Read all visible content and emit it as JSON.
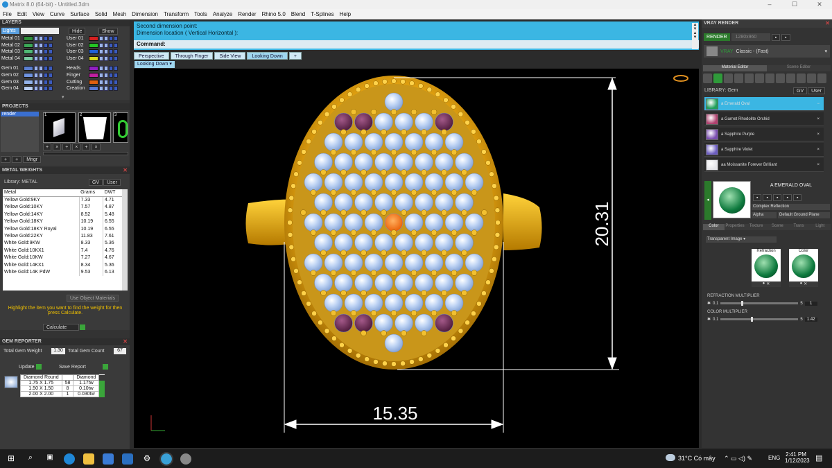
{
  "window": {
    "title": "Matrix 8.0 (64-bit) - Untitled.3dm",
    "controls": [
      "–",
      "☐",
      "✕"
    ]
  },
  "menu": [
    "File",
    "Edit",
    "View",
    "Curve",
    "Surface",
    "Solid",
    "Mesh",
    "Dimension",
    "Transform",
    "Tools",
    "Analyze",
    "Render",
    "Rhino 5.0",
    "Blend",
    "T-Splines",
    "Help"
  ],
  "layers": {
    "title": "LAYERS",
    "lights_label": "Lights",
    "hide_label": "Hide",
    "show_label": "Show",
    "left": [
      {
        "name": "Metal 01",
        "color": "#2f8f3a"
      },
      {
        "name": "Metal 02",
        "color": "#3aa655"
      },
      {
        "name": "Metal 03",
        "color": "#4fb874"
      },
      {
        "name": "Metal 04",
        "color": "#79c9a0"
      },
      {
        "name": "Gem 01",
        "color": "#5b7fd0"
      },
      {
        "name": "Gem 02",
        "color": "#6f93e0"
      },
      {
        "name": "Gem 03",
        "color": "#93b2ea"
      },
      {
        "name": "Gem 04",
        "color": "#b8cdf2"
      }
    ],
    "right": [
      {
        "name": "User 01",
        "color": "#d42020"
      },
      {
        "name": "User 02",
        "color": "#24c424"
      },
      {
        "name": "User 03",
        "color": "#2060d8"
      },
      {
        "name": "User 04",
        "color": "#d8d820"
      },
      {
        "name": "Heads",
        "color": "#9020c0"
      },
      {
        "name": "Finger",
        "color": "#c020a0"
      },
      {
        "name": "Cutting",
        "color": "#e06010"
      },
      {
        "name": "Creation",
        "color": "#5a7ad6"
      }
    ]
  },
  "projects": {
    "title": "PROJECTS",
    "item": "render",
    "thumb_nums": [
      "1",
      "2",
      "3"
    ],
    "mngr_label": "Mngr"
  },
  "metal_weights": {
    "title": "METAL WEIGHTS",
    "library_label": "Library: METAL",
    "gv_label": "GV",
    "user_label": "User",
    "columns": [
      "Metal",
      "Grams",
      "DWT"
    ],
    "rows": [
      [
        "Yellow Gold:9KY",
        "7.33",
        "4.71"
      ],
      [
        "Yellow Gold:10KY",
        "7.57",
        "4.87"
      ],
      [
        "Yellow Gold:14KY",
        "8.52",
        "5.48"
      ],
      [
        "Yellow Gold:18KY",
        "10.19",
        "6.55"
      ],
      [
        "Yellow Gold:18KY Royal",
        "10.19",
        "6.55"
      ],
      [
        "Yellow Gold:22KY",
        "11.83",
        "7.61"
      ],
      [
        "White Gold:9KW",
        "8.33",
        "5.36"
      ],
      [
        "White Gold:10KX1",
        "7.4",
        "4.76"
      ],
      [
        "White Gold:10KW",
        "7.27",
        "4.67"
      ],
      [
        "White Gold:14KX1",
        "8.34",
        "5.36"
      ],
      [
        "White Gold:14K PdW",
        "9.53",
        "6.13"
      ]
    ],
    "use_object_materials": "Use Object Materials",
    "hint": "Highlight the item you want to find the weight for then press Calculate.",
    "calculate_label": "Calculate"
  },
  "gem_reporter": {
    "title": "GEM REPORTER",
    "total_weight_label": "Total Gem Weight",
    "total_weight": "1.30",
    "total_count_label": "Total Gem Count",
    "total_count": "67",
    "update_label": "Update",
    "save_label": "Save Report",
    "columns": [
      "Diamond Round",
      "",
      "Diamond"
    ],
    "rows": [
      [
        "1.75 X 1.75",
        "58",
        "1.17tw"
      ],
      [
        "1.50 X 1.50",
        "8",
        "0.10tw"
      ],
      [
        "2.00 X 2.00",
        "1",
        "0.030tw"
      ]
    ]
  },
  "command": {
    "line1": "Second dimension point:",
    "line2": "Dimension location ( Vertical  Horizontal ):",
    "prompt": "Command:"
  },
  "view_tabs": [
    {
      "label": "Perspective"
    },
    {
      "label": "Through Finger"
    },
    {
      "label": "Side View"
    },
    {
      "label": "Looking Down",
      "active": true
    }
  ],
  "view_add": "+",
  "viewport": {
    "label": "Looking Down",
    "dim_vertical": "20.31",
    "dim_horizontal": "15.35"
  },
  "vray": {
    "title": "VRAY RENDER",
    "render_label": "RENDER",
    "resolution": "1280x960",
    "preset_label": "VRAY",
    "preset": "Classic - (Fast)",
    "tabs": [
      "Material Editor",
      "Scene Editor"
    ],
    "library_label": "LIBRARY: Gem",
    "gv_label": "GV",
    "user_label": "User",
    "materials": [
      {
        "name": "a Emerald Oval",
        "color": "#1f9f5a",
        "selected": true
      },
      {
        "name": "a Garnet Rhodolite Orchid",
        "color": "#b0406e"
      },
      {
        "name": "a Sapphire Purple",
        "color": "#7a4db0"
      },
      {
        "name": "a Sapphire Violet",
        "color": "#6b5cc0"
      },
      {
        "name": "aa Moissanite Forever Brilliant",
        "color": "#e6e6ea"
      }
    ],
    "preview_name": "A EMERALD OVAL",
    "mat_type": "Complex Reflection",
    "alpha_label": "Alpha",
    "ground": "Default Ground Plane",
    "sub_tabs": [
      "Color",
      "Properties",
      "Texture",
      "Scene",
      "Trans",
      "Light"
    ],
    "transparency": "Transparent Image",
    "refraction_label": "Refraction",
    "color_label": "Color",
    "refraction_mult_label": "REFRACTION MULTIPLIER",
    "refraction_min": "0.1",
    "refraction_max": "5",
    "refraction_value": "1",
    "color_mult_label": "COLOR MULTIPLIER",
    "color_min": "0.1",
    "color_max": "5",
    "color_value": "1.42"
  },
  "taskbar": {
    "weather": "31°C  Có mây",
    "lang": "ENG",
    "time": "2:41 PM",
    "date": "1/12/2023"
  }
}
